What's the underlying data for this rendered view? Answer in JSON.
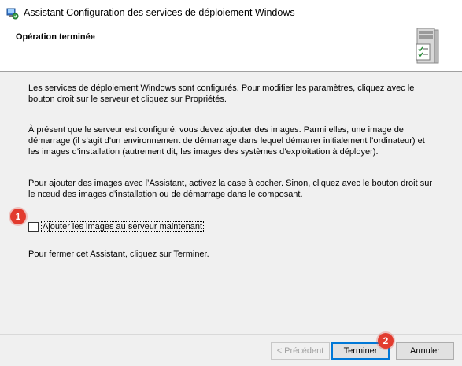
{
  "window": {
    "title": "Assistant Configuration des services de déploiement Windows"
  },
  "header": {
    "title": "Opération terminée",
    "icon": "server-icon"
  },
  "content": {
    "para1": "Les services de déploiement Windows sont configurés. Pour modifier les paramètres, cliquez avec le bouton droit sur le serveur et cliquez sur Propriétés.",
    "para2": "À présent que le serveur est configuré, vous devez ajouter des images. Parmi elles, une image de démarrage (il s’agit d’un environnement de démarrage dans lequel démarrer initialement l’ordinateur) et les images d’installation (autrement dit, les images des systèmes d’exploitation à déployer).",
    "para3": "Pour ajouter des images avec l’Assistant, activez la case à cocher. Sinon, cliquez avec le bouton droit sur le nœud des images d’installation ou de démarrage dans le composant.",
    "checkbox_label": "Ajouter les images au serveur maintenant",
    "checkbox_checked": false,
    "para4": "Pour fermer cet Assistant, cliquez sur Terminer."
  },
  "annotations": {
    "badge1": "1",
    "badge2": "2"
  },
  "buttons": {
    "previous": "< Précédent",
    "finish": "Terminer",
    "cancel": "Annuler"
  },
  "colors": {
    "accent": "#0078d7",
    "badge": "#e23b2e"
  }
}
